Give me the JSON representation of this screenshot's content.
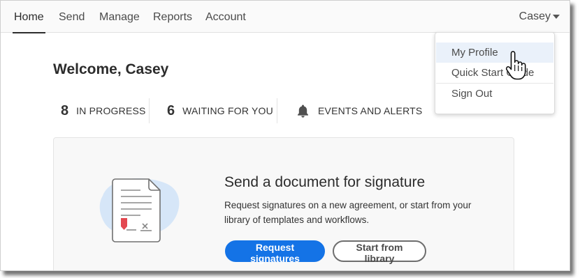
{
  "nav": {
    "items": [
      {
        "label": "Home",
        "active": true
      },
      {
        "label": "Send"
      },
      {
        "label": "Manage"
      },
      {
        "label": "Reports"
      },
      {
        "label": "Account"
      }
    ],
    "user": "Casey"
  },
  "welcome": "Welcome, Casey",
  "stats": [
    {
      "count": "8",
      "label": "IN PROGRESS"
    },
    {
      "count": "6",
      "label": "WAITING FOR YOU"
    },
    {
      "icon": "bell-icon",
      "label": "EVENTS AND ALERTS"
    }
  ],
  "card": {
    "title": "Send a document for signature",
    "description": "Request signatures on a new agreement, or start from your library of templates and workflows.",
    "primary_button": "Request signatures",
    "secondary_button": "Start from library"
  },
  "user_menu": {
    "items": [
      "My Profile",
      "Quick Start Guide",
      "Sign Out"
    ],
    "hovered": "My Profile"
  },
  "colors": {
    "accent": "#1473e6",
    "hover_bg": "#eaf1fa",
    "illustration_blob": "#d6e6f8",
    "marker_red": "#e34850"
  }
}
